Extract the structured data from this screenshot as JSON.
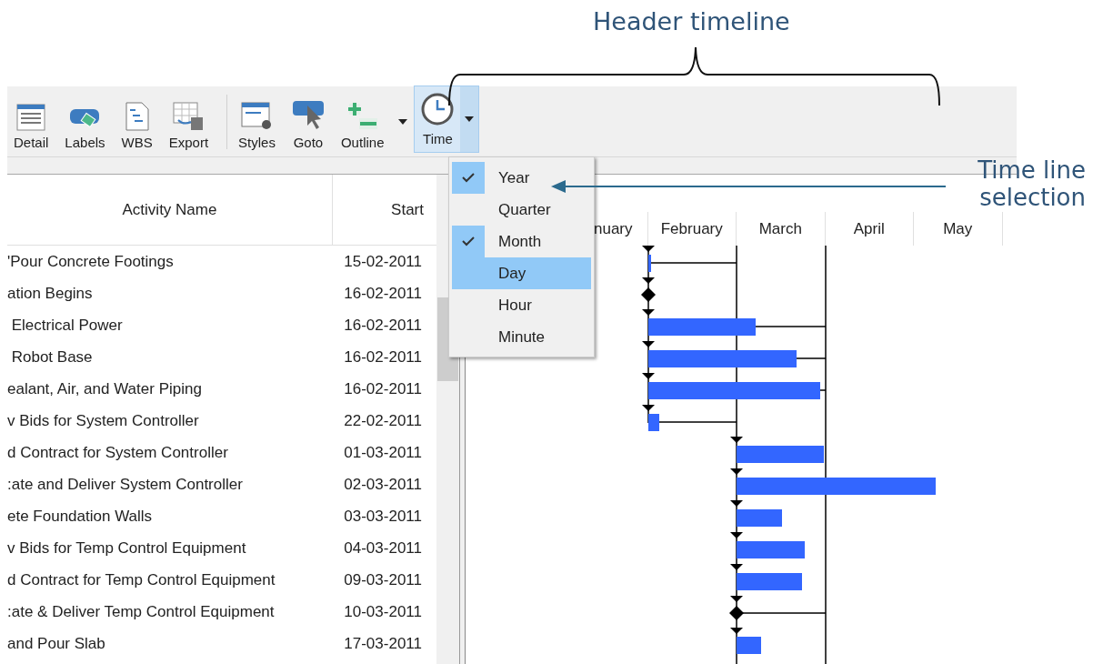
{
  "callouts": {
    "header": "Header timeline",
    "menu": "Time line selection"
  },
  "toolbar": {
    "groups": [
      [
        {
          "label": "Detail"
        },
        {
          "label": "Labels"
        },
        {
          "label": "WBS"
        },
        {
          "label": "Export"
        }
      ],
      [
        {
          "label": "Styles"
        },
        {
          "label": "Goto"
        },
        {
          "label": "Outline"
        }
      ]
    ],
    "time_button": {
      "label": "Time",
      "selected": true
    }
  },
  "table": {
    "columns": [
      "Activity Name",
      "Start"
    ],
    "rows": [
      {
        "name": "'Pour Concrete Footings",
        "start": "15-02-2011"
      },
      {
        "name": "ation Begins",
        "start": "16-02-2011"
      },
      {
        "name": " Electrical Power",
        "start": "16-02-2011"
      },
      {
        "name": " Robot Base",
        "start": "16-02-2011"
      },
      {
        "name": "ealant, Air, and Water Piping",
        "start": "16-02-2011"
      },
      {
        "name": "v Bids for System Controller",
        "start": "22-02-2011"
      },
      {
        "name": "d Contract for System Controller",
        "start": "01-03-2011"
      },
      {
        "name": ":ate and Deliver System Controller",
        "start": "02-03-2011"
      },
      {
        "name": "ete Foundation Walls",
        "start": "03-03-2011"
      },
      {
        "name": "v Bids for Temp Control Equipment",
        "start": "04-03-2011"
      },
      {
        "name": "d Contract for Temp Control Equipment",
        "start": "09-03-2011"
      },
      {
        "name": ":ate & Deliver Temp Control Equipment",
        "start": "10-03-2011"
      },
      {
        "name": "and Pour Slab",
        "start": "17-03-2011"
      }
    ]
  },
  "timeline": {
    "months": [
      "nuary",
      "February",
      "March",
      "April",
      "May"
    ]
  },
  "time_menu": [
    {
      "label": "Year",
      "checked": true,
      "selected": false
    },
    {
      "label": "Quarter",
      "checked": false,
      "selected": false
    },
    {
      "label": "Month",
      "checked": true,
      "selected": false
    },
    {
      "label": "Day",
      "checked": false,
      "selected": true
    },
    {
      "label": "Hour",
      "checked": false,
      "selected": false
    },
    {
      "label": "Minute",
      "checked": false,
      "selected": false
    }
  ]
}
